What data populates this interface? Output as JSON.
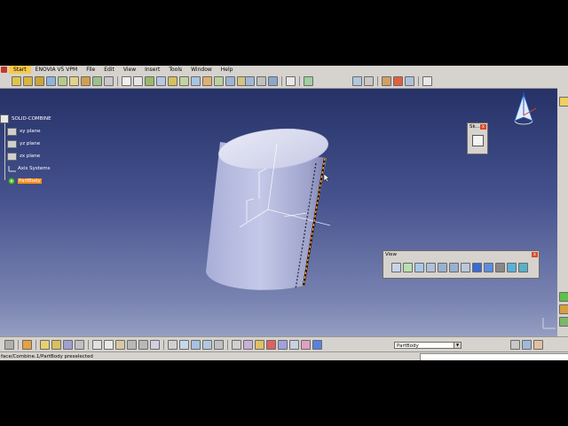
{
  "menu": {
    "items": [
      "Start",
      "ENOVIA V5 VPM",
      "File",
      "Edit",
      "View",
      "Insert",
      "Tools",
      "Window",
      "Help"
    ]
  },
  "tree": {
    "root": "SOLID-COMBINE",
    "children": [
      "xy plane",
      "yz plane",
      "zx plane",
      "Axis Systems",
      "PartBody"
    ]
  },
  "panels": {
    "sketch_title": "Sk...",
    "view_title": "View"
  },
  "bottom": {
    "body_select": "PartBody"
  },
  "status": {
    "text": "face/Combine.1/PartBody preselected"
  },
  "colors": {
    "selection": "#ff8c1a",
    "background_top": "#1e2a5e",
    "background_bottom": "#a9b0cc",
    "preselect_edge": "#ff9a1f"
  }
}
